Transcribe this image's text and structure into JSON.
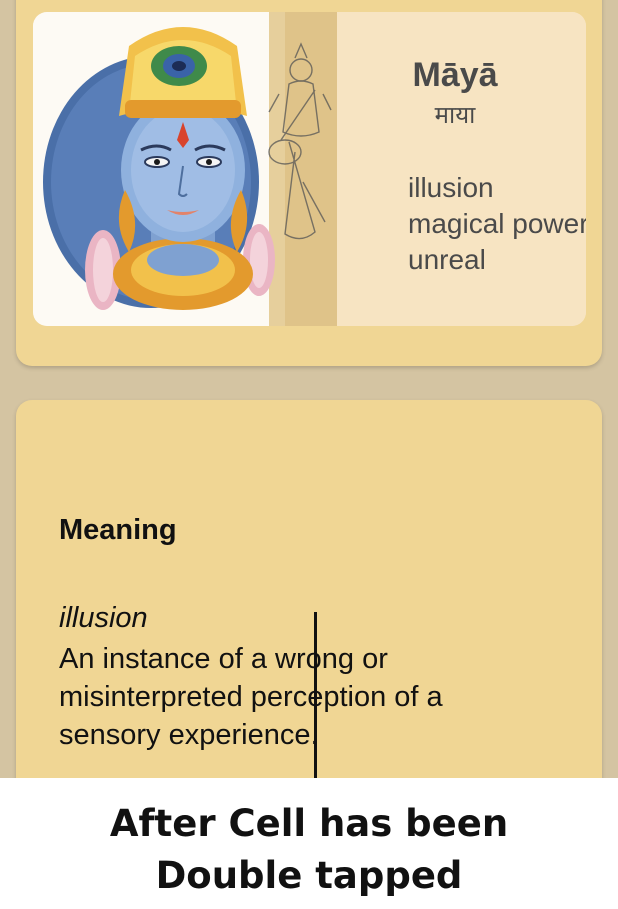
{
  "word_card": {
    "term": "Māyā",
    "devanagari": "माया",
    "translations": [
      "illusion",
      "magical power",
      "unreal"
    ],
    "illustration_icon": "deity-watercolor-illustration"
  },
  "meaning_card": {
    "heading": "Meaning",
    "sense_term": "illusion",
    "definition": "An instance of a wrong or misinterpreted perception of a sensory experience."
  },
  "caption": {
    "line1": "After Cell has been",
    "line2": "Double tapped"
  },
  "colors": {
    "background": "#d4c4a2",
    "card": "#f0d694",
    "word_panel": "#f7e4c2",
    "caption_band": "#ffffff"
  }
}
